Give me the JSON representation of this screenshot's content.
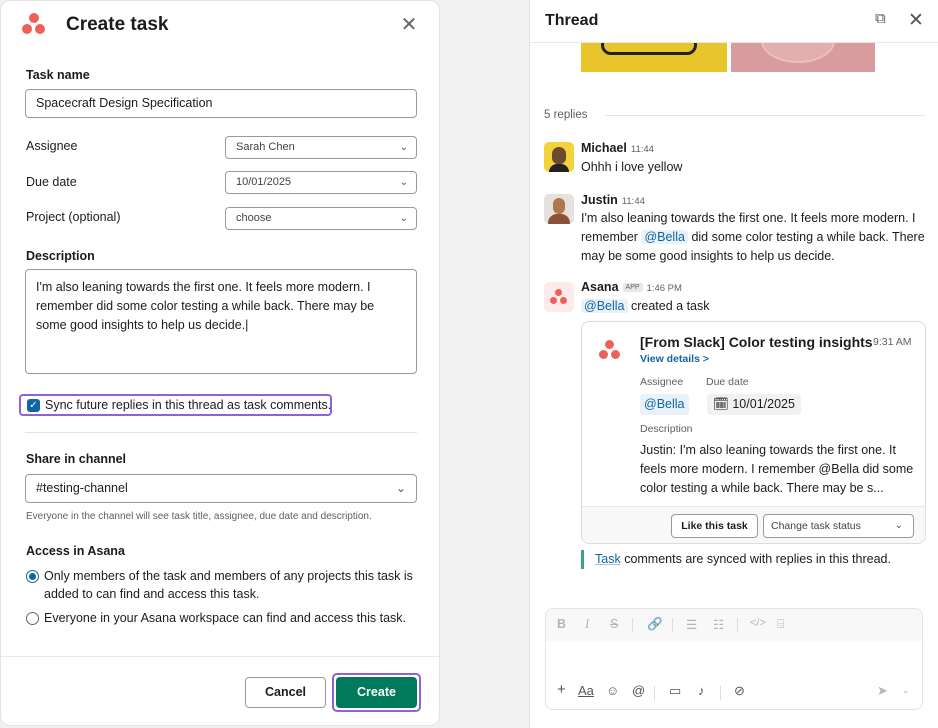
{
  "modal": {
    "title": "Create task",
    "close_icon": "close-icon",
    "task_name_label": "Task name",
    "task_name_value": "Spacecraft Design Specification",
    "assignee_label": "Assignee",
    "assignee_value": "Sarah Chen",
    "due_date_label": "Due date",
    "due_date_value": "10/01/2025",
    "project_label": "Project (optional)",
    "project_value": "choose",
    "description_label": "Description",
    "description_value": "I'm also leaning towards the first one. It feels more modern. I remember did some color testing a while back. There may be some good insights to help us decide.|",
    "sync_checkbox": "Sync future replies in this thread as task comments.",
    "share_label": "Share in channel",
    "channel_value": "#testing-channel",
    "share_help": "Everyone in the channel will see task title, assignee, due date and description.",
    "access_label": "Access in Asana",
    "access_option_1": "Only members of the task and members of any projects this task is added to can find and access this task.",
    "access_option_2": "Everyone in your Asana workspace can find and access this task.",
    "cancel_label": "Cancel",
    "create_label": "Create"
  },
  "thread": {
    "title": "Thread",
    "replies_count": "5 replies",
    "messages": [
      {
        "author": "Michael",
        "time": "11:44",
        "text": "Ohhh i love yellow"
      },
      {
        "author": "Justin",
        "time": "11:44",
        "text_1": "I'm also leaning towards the first one. It feels more modern. I remember",
        "mention": "@Bella",
        "text_2": "did some color testing a while back. There may be some good insights to help us decide."
      },
      {
        "author": "Asana",
        "badge": "APP",
        "time": "1:46 PM",
        "mention": "@Bella",
        "text": "created a task"
      }
    ],
    "card": {
      "title": "[From Slack] Color testing insights",
      "time": "9:31 AM",
      "view_details": "View details >",
      "assignee_label": "Assignee",
      "due_date_label": "Due date",
      "assignee_value": "@Bella",
      "due_date_value": "10/01/2025",
      "description_label": "Description",
      "description_1": "Justin: I'm also leaning towards the first one. It feels more modern. I remember",
      "description_mention": "@Bella",
      "description_2": "did some color testing a while back. There may be s...",
      "like_label": "Like this task",
      "status_placeholder": "Change task status"
    },
    "synced_link": "Task",
    "synced_text": "comments are synced with replies in this thread."
  },
  "colors": {
    "asana": "#f0605a",
    "create_button": "#007a5a",
    "focus_ring": "#8f62d8",
    "link": "#1264a3"
  }
}
